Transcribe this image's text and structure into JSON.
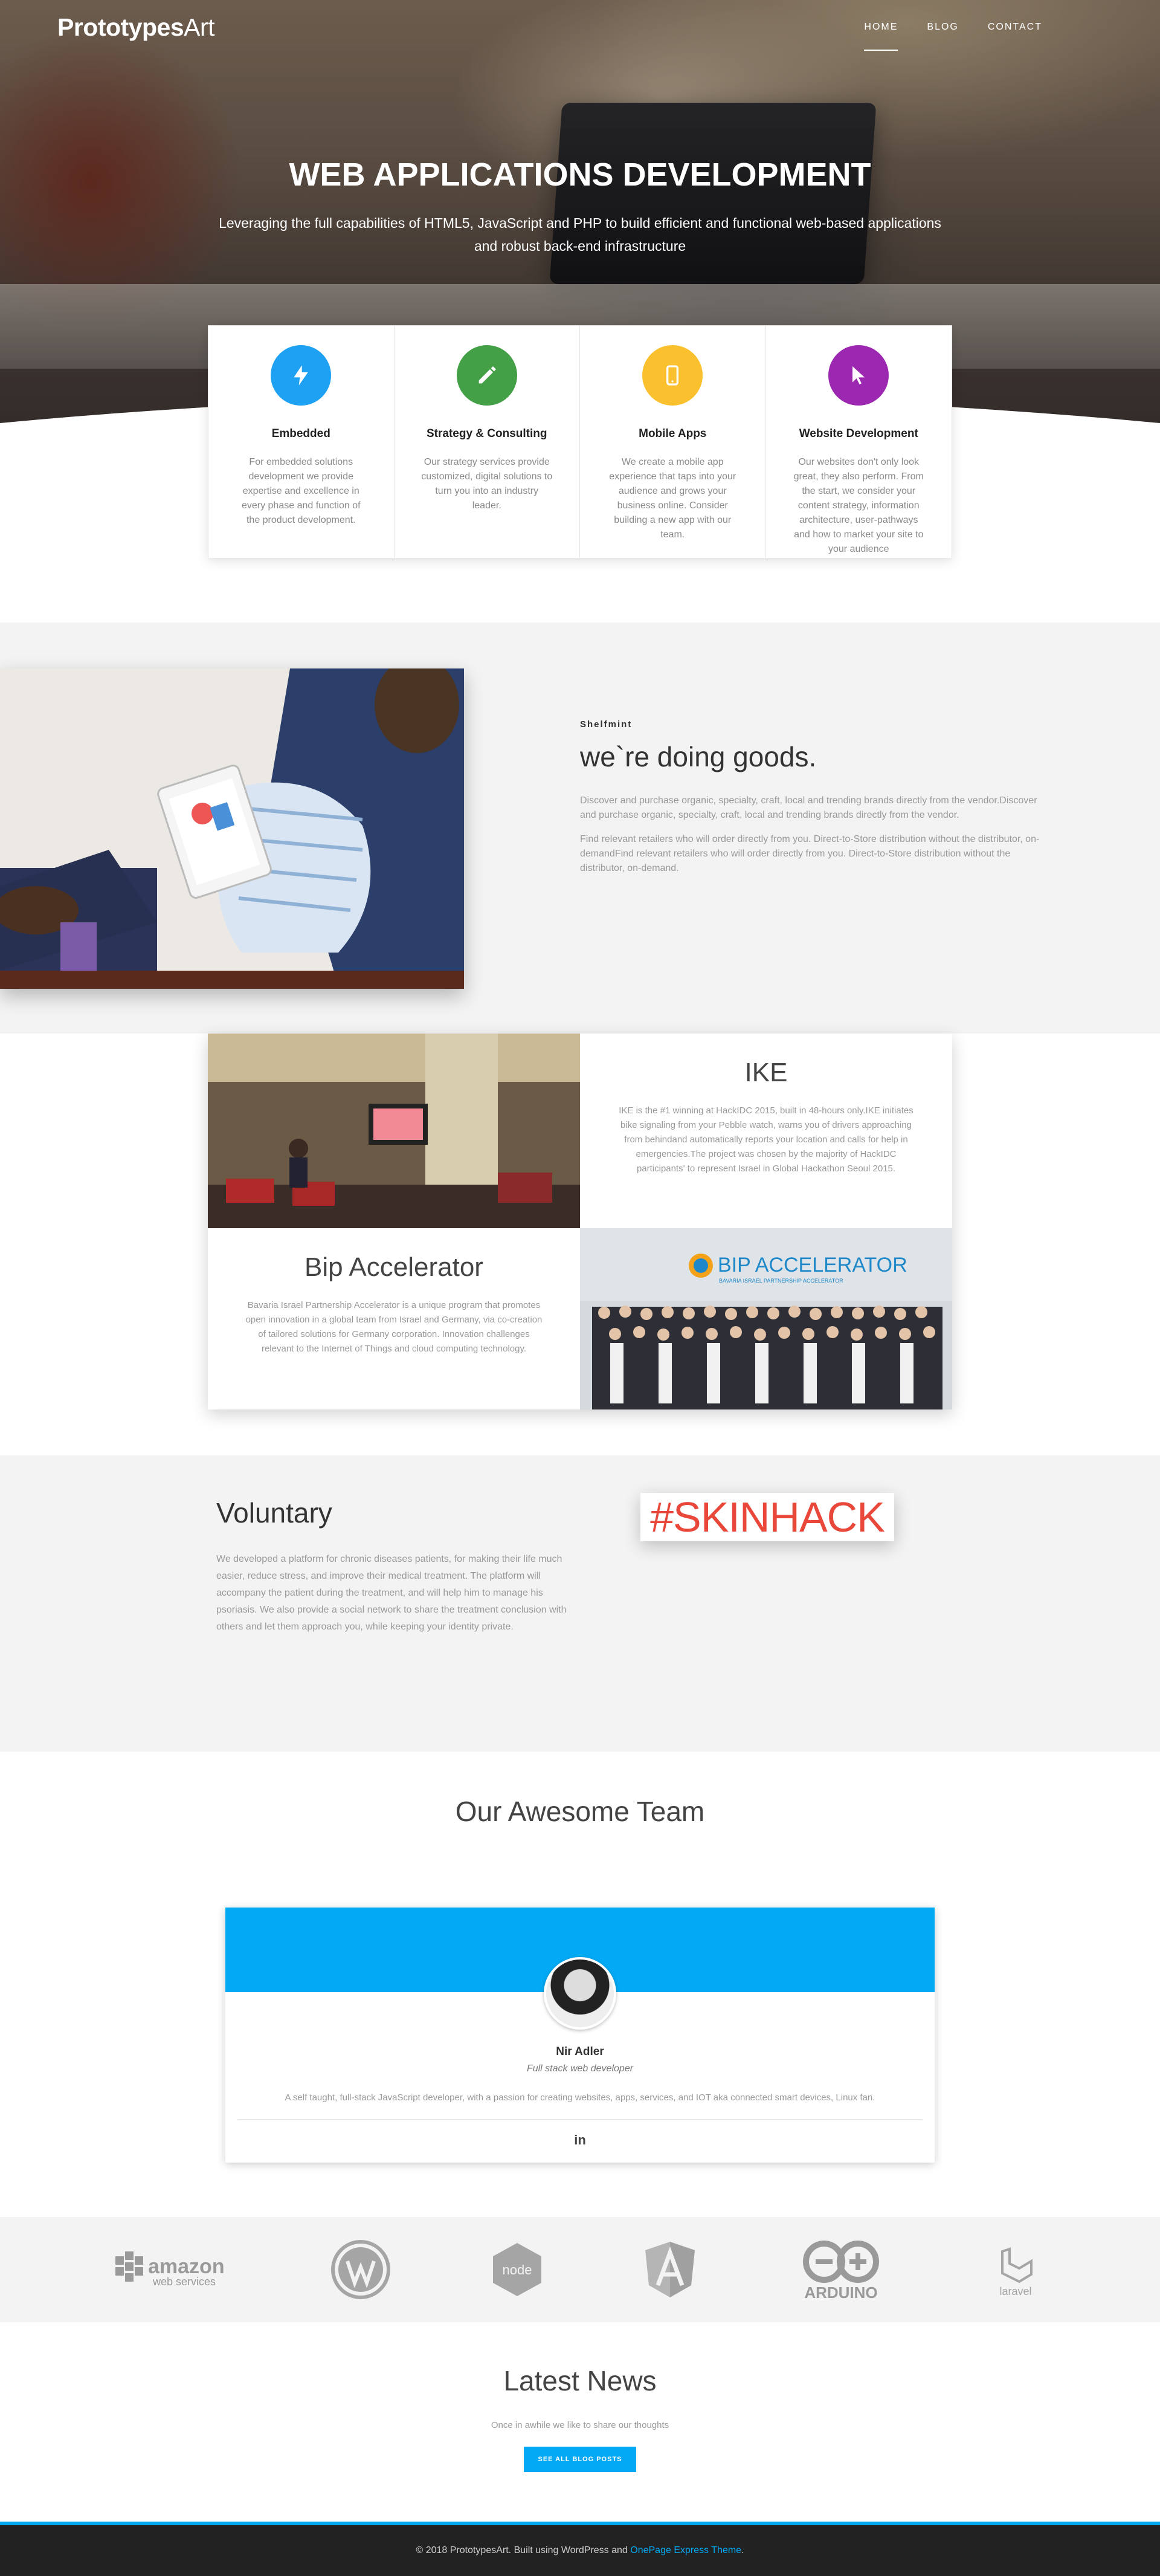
{
  "header": {
    "logo_bold": "Prototypes",
    "logo_thin": "Art",
    "menu": [
      {
        "label": "HOME"
      },
      {
        "label": "BLOG"
      },
      {
        "label": "CONTACT"
      }
    ]
  },
  "hero": {
    "title": "WEB APPLICATIONS DEVELOPMENT",
    "subtitle": "Leveraging the full capabilities of HTML5, JavaScript and PHP to build efficient and functional web-based applications and robust back-end infrastructure"
  },
  "services": [
    {
      "title": "Embedded",
      "text": "For embedded solutions development we provide expertise and excellence in every phase and function of the product development.",
      "color": "#1ea1f2",
      "icon": "bolt-icon"
    },
    {
      "title": "Strategy & Consulting",
      "text": "Our strategy services provide customized, digital solutions to turn you into an industry leader.",
      "color": "#43a047",
      "icon": "pencil-icon"
    },
    {
      "title": "Mobile Apps",
      "text": "We create a mobile app experience that taps into your audience and grows your business online. Consider building a new app with our team.",
      "color": "#fbc02d",
      "icon": "mobile-icon"
    },
    {
      "title": "Website Development",
      "text": "Our websites don't only look great, they also perform. From the start, we consider your content strategy, information architecture, user-pathways and how to market your site to your audience",
      "color": "#9c27b0",
      "icon": "cursor-icon"
    }
  ],
  "shelfmint": {
    "kicker": "Shelfmint",
    "title": "we`re doing goods.",
    "paragraphs": [
      "Discover and purchase organic, specialty, craft, local and trending brands directly from the vendor.Discover and purchase organic, specialty, craft, local and trending brands directly from the vendor.",
      "Find relevant retailers who will order directly from you. Direct-to-Store distribution without the distributor, on-demandFind relevant retailers who will order directly from you. Direct-to-Store distribution without the distributor, on-demand."
    ]
  },
  "projects": {
    "ike": {
      "title": "IKE",
      "text": "IKE is the #1 winning at HackIDC 2015, built in 48-hours only.IKE initiates bike signaling from your Pebble watch, warns you of drivers approaching from behindand automatically reports your location and calls for help in emergencies.The project was chosen by the majority of HackIDC participants' to represent Israel in Global Hackathon Seoul 2015."
    },
    "bip": {
      "title": "Bip Accelerator",
      "text": "Bavaria Israel Partnership Accelerator is a unique program that promotes open innovation in a global team from Israel and Germany, via co-creation of tailored solutions for Germany corporation. Innovation challenges relevant to the Internet of Things and cloud computing technology.",
      "banner_title": "BIP ACCELERATOR",
      "banner_sub": "BAVARIA ISRAEL PARTNERSHIP ACCELERATOR"
    }
  },
  "voluntary": {
    "title": "Voluntary",
    "text": "We developed a platform for chronic diseases patients, for making their life much easier, reduce stress, and improve their medical treatment. The platform will accompany the patient during the treatment, and will help him to manage his psoriasis. We also provide a social network to share the treatment conclusion with others and let them approach you, while keeping your identity private.",
    "badge": "#SKINHACK"
  },
  "team": {
    "title": "Our Awesome Team",
    "member": {
      "name": "Nir Adler",
      "role": "Full stack web developer",
      "bio": "A self taught, full-stack JavaScript developer, with a passion for creating websites, apps, services, and IOT aka connected smart devices, Linux fan.",
      "social": "in"
    }
  },
  "logos": {
    "amazon_line1": "amazon",
    "amazon_line2": "web services",
    "node": "node",
    "arduino": "ARDUINO",
    "laravel": "laravel"
  },
  "news": {
    "title": "Latest News",
    "subtitle": "Once in awhile we like to share our thoughts",
    "button": "SEE ALL BLOG POSTS"
  },
  "footer": {
    "text": "© 2018 PrototypesArt. Built using WordPress and ",
    "link": "OnePage Express Theme",
    "end": "."
  }
}
